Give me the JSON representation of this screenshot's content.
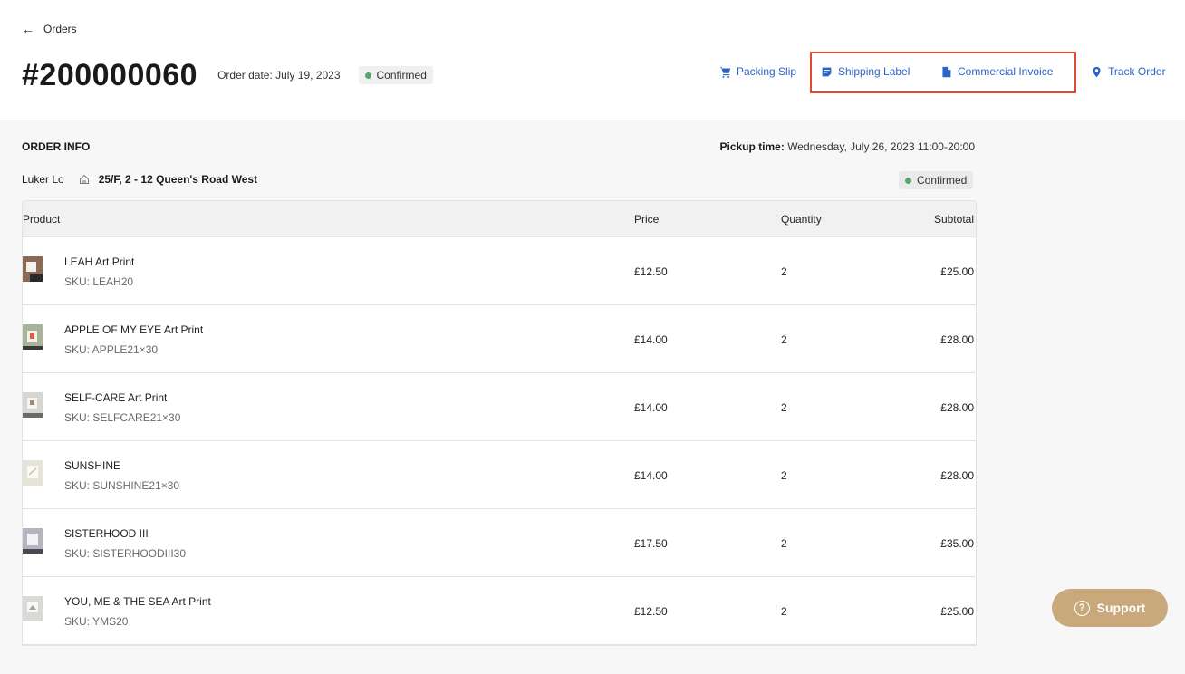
{
  "nav": {
    "back_label": "Orders"
  },
  "order": {
    "number": "#200000060",
    "date_text": "Order date: July 19, 2023",
    "status": "Confirmed"
  },
  "actions": {
    "packing_slip": "Packing Slip",
    "shipping_label": "Shipping Label",
    "commercial_invoice": "Commercial Invoice",
    "track_order": "Track Order"
  },
  "info": {
    "heading": "ORDER INFO",
    "pickup_label": "Pickup time:",
    "pickup_value": "Wednesday, July 26, 2023 11:00-20:00",
    "customer_name": "Luker Lo",
    "address": "25/F, 2 - 12 Queen's Road West",
    "status": "Confirmed"
  },
  "table": {
    "headers": {
      "product": "Product",
      "price": "Price",
      "quantity": "Quantity",
      "subtotal": "Subtotal"
    },
    "rows": [
      {
        "name": "LEAH Art Print",
        "sku": "SKU: LEAH20",
        "price": "£12.50",
        "qty": "2",
        "subtotal": "£25.00"
      },
      {
        "name": "APPLE OF MY EYE Art Print",
        "sku": "SKU: APPLE21×30",
        "price": "£14.00",
        "qty": "2",
        "subtotal": "£28.00"
      },
      {
        "name": "SELF-CARE Art Print",
        "sku": "SKU: SELFCARE21×30",
        "price": "£14.00",
        "qty": "2",
        "subtotal": "£28.00"
      },
      {
        "name": "SUNSHINE",
        "sku": "SKU: SUNSHINE21×30",
        "price": "£14.00",
        "qty": "2",
        "subtotal": "£28.00"
      },
      {
        "name": "SISTERHOOD III",
        "sku": "SKU: SISTERHOODIII30",
        "price": "£17.50",
        "qty": "2",
        "subtotal": "£35.00"
      },
      {
        "name": "YOU, ME & THE SEA Art Print",
        "sku": "SKU: YMS20",
        "price": "£12.50",
        "qty": "2",
        "subtotal": "£25.00"
      }
    ]
  },
  "support": {
    "label": "Support"
  },
  "colors": {
    "link": "#2b63c8",
    "highlight": "#e04a2f",
    "status_dot": "#5aa469",
    "support_bg": "#c9a97c"
  }
}
